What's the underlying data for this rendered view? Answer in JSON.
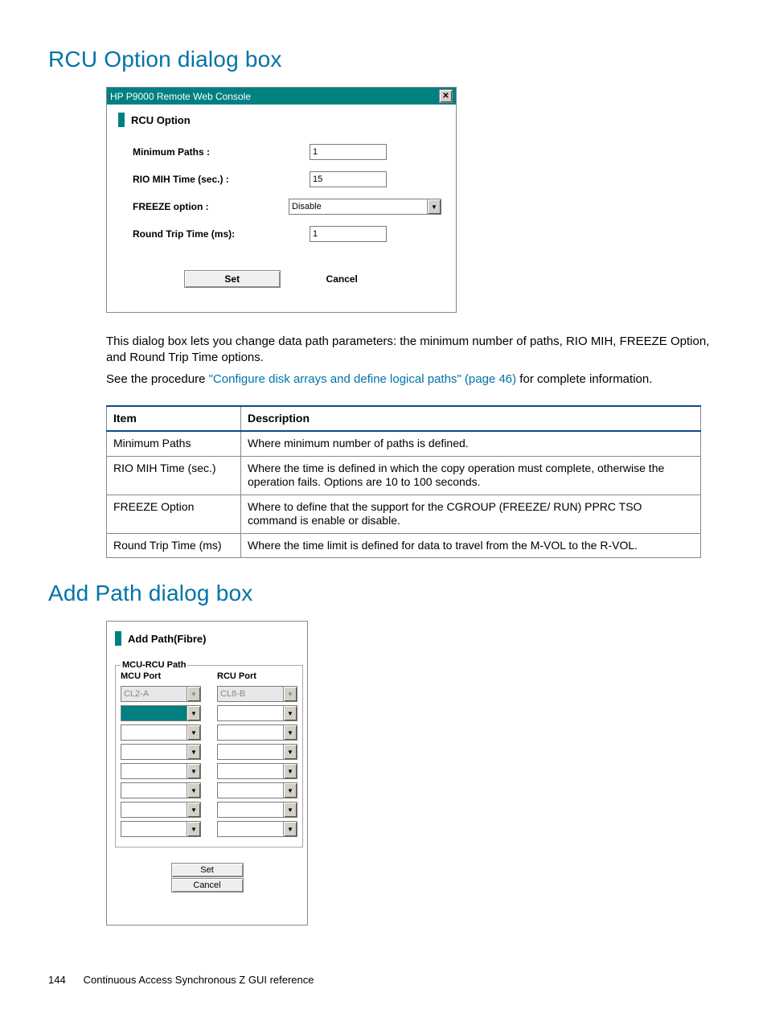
{
  "headings": {
    "rcu": "RCU Option dialog box",
    "addpath": "Add Path dialog box"
  },
  "rcu_dialog": {
    "window_title": "HP P9000 Remote Web Console",
    "panel_title": "RCU Option",
    "fields": {
      "min_paths_label": "Minimum Paths :",
      "min_paths_value": "1",
      "rio_label": "RIO MIH Time (sec.) :",
      "rio_value": "15",
      "freeze_label": "FREEZE option :",
      "freeze_value": "Disable",
      "rtt_label": "Round Trip Time (ms):",
      "rtt_value": "1"
    },
    "buttons": {
      "set": "Set",
      "cancel": "Cancel"
    }
  },
  "body": {
    "p1": "This dialog box lets you change data path parameters: the minimum number of paths, RIO MIH, FREEZE Option, and Round Trip Time options.",
    "p2a": "See the procedure ",
    "p2link": "\"Configure disk arrays and define logical paths\" (page 46)",
    "p2b": " for complete information."
  },
  "table": {
    "head_item": "Item",
    "head_desc": "Description",
    "rows": [
      {
        "item": "Minimum Paths",
        "desc": "Where minimum number of paths is defined."
      },
      {
        "item": "RIO MIH Time (sec.)",
        "desc": "Where the time is defined in which the copy operation must complete, otherwise the operation fails. Options are 10 to 100 seconds."
      },
      {
        "item": "FREEZE Option",
        "desc": "Where to define that the support for the CGROUP (FREEZE/ RUN) PPRC TSO command is enable or disable."
      },
      {
        "item": "Round Trip Time (ms)",
        "desc": "Where the time limit is defined for data to travel from the M-VOL to the R-VOL."
      }
    ]
  },
  "addpath": {
    "panel_title": "Add Path(Fibre)",
    "fieldset_label": "MCU-RCU Path",
    "col_mcu": "MCU Port",
    "col_rcu": "RCU Port",
    "mcu_disabled_value": "CL2-A",
    "rcu_disabled_value": "CL8-B",
    "buttons": {
      "set": "Set",
      "cancel": "Cancel"
    }
  },
  "footer": {
    "page_number": "144",
    "chapter": "Continuous Access Synchronous Z GUI reference"
  }
}
